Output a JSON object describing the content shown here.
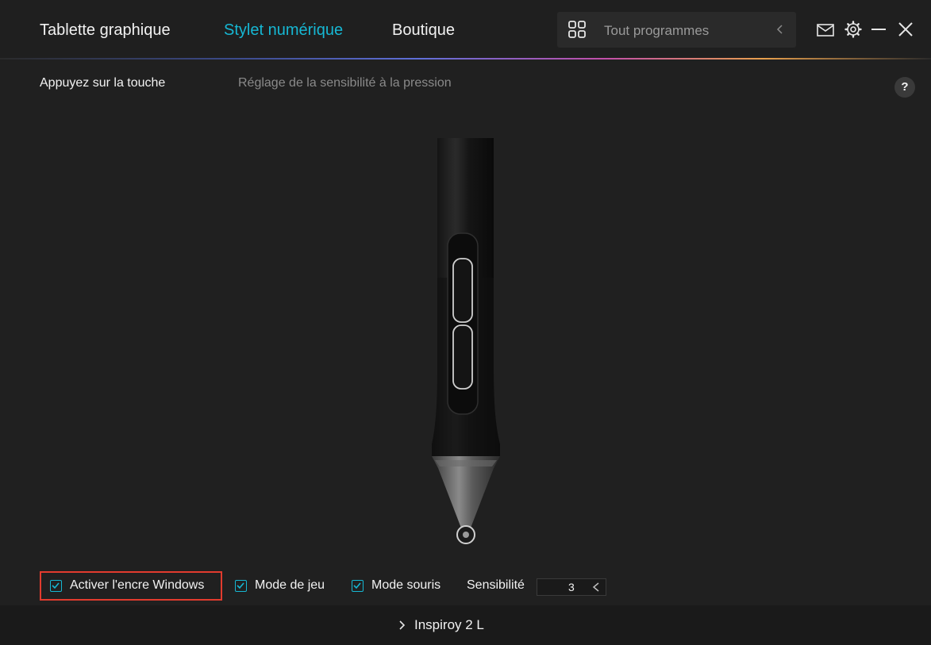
{
  "nav": {
    "tabs": [
      {
        "label": "Tablette graphique",
        "active": false
      },
      {
        "label": "Stylet numérique",
        "active": true
      },
      {
        "label": "Boutique",
        "active": false
      }
    ]
  },
  "search": {
    "label": "Tout programmes",
    "icon": "grid-icon"
  },
  "window_controls": {
    "icons": [
      "mail-icon",
      "gear-icon",
      "minimize-icon",
      "close-icon"
    ]
  },
  "subtabs": [
    {
      "label": "Appuyez sur la touche",
      "active": true
    },
    {
      "label": "Réglage de la sensibilité à la pression",
      "active": false
    }
  ],
  "help": {
    "label": "?"
  },
  "options": {
    "windows_ink": {
      "label": "Activer l'encre Windows",
      "checked": true
    },
    "game_mode": {
      "label": "Mode de jeu",
      "checked": true
    },
    "mouse_mode": {
      "label": "Mode souris",
      "checked": true
    },
    "sensitivity": {
      "label": "Sensibilité",
      "value": "3"
    }
  },
  "footer": {
    "device": "Inspiroy 2 L"
  },
  "colors": {
    "accent": "#16b7d3",
    "highlight": "#e23b2e",
    "background": "#202020"
  }
}
